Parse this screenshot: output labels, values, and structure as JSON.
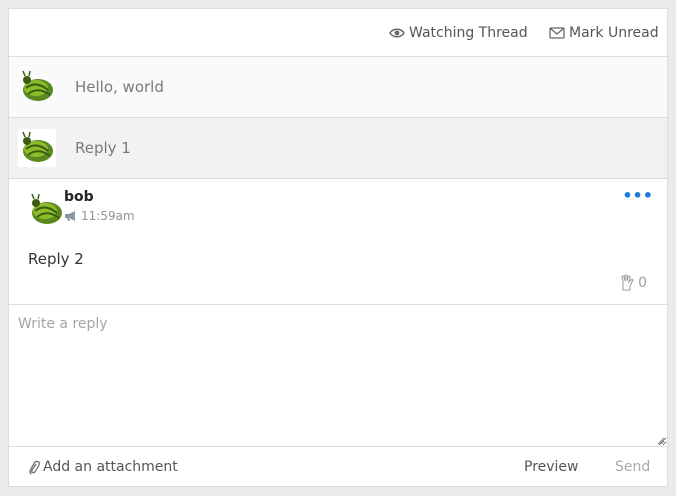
{
  "toolbar": {
    "watch_label": "Watching Thread",
    "unread_label": "Mark Unread",
    "watch_icon": "eye-icon",
    "unread_icon": "envelope-icon"
  },
  "thread": {
    "collapsed": [
      {
        "text": "Hello, world"
      },
      {
        "text": "Reply 1"
      }
    ],
    "expanded": {
      "author": "bob",
      "time": "11:59am",
      "body": "Reply 2",
      "likes": "0"
    }
  },
  "reply": {
    "placeholder": "Write a reply"
  },
  "footer": {
    "attach_label": "Add an attachment",
    "preview_label": "Preview",
    "send_label": "Send"
  },
  "colors": {
    "accent": "#1a7fd4",
    "border": "#dcdcdc",
    "background": "#ebebeb"
  }
}
